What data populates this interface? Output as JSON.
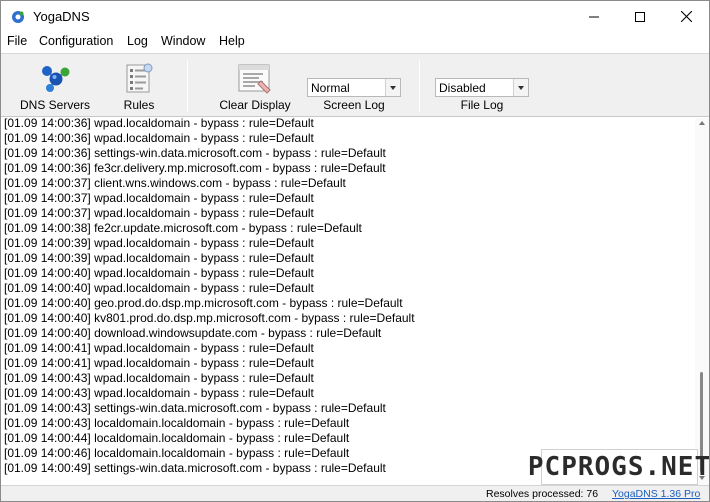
{
  "window": {
    "title": "YogaDNS"
  },
  "menu": [
    "File",
    "Configuration",
    "Log",
    "Window",
    "Help"
  ],
  "toolbar": {
    "dns_servers": "DNS Servers",
    "rules": "Rules",
    "clear_display": "Clear Display",
    "screen_log": {
      "value": "Normal",
      "caption": "Screen Log"
    },
    "file_log": {
      "value": "Disabled",
      "caption": "File Log"
    }
  },
  "log": [
    "[01.09 14:00:36] wpad.localdomain - bypass : rule=Default",
    "[01.09 14:00:36] wpad.localdomain - bypass : rule=Default",
    "[01.09 14:00:36] settings-win.data.microsoft.com - bypass : rule=Default",
    "[01.09 14:00:36] fe3cr.delivery.mp.microsoft.com - bypass : rule=Default",
    "[01.09 14:00:37] client.wns.windows.com - bypass : rule=Default",
    "[01.09 14:00:37] wpad.localdomain - bypass : rule=Default",
    "[01.09 14:00:37] wpad.localdomain - bypass : rule=Default",
    "[01.09 14:00:38] fe2cr.update.microsoft.com - bypass : rule=Default",
    "[01.09 14:00:39] wpad.localdomain - bypass : rule=Default",
    "[01.09 14:00:39] wpad.localdomain - bypass : rule=Default",
    "[01.09 14:00:40] wpad.localdomain - bypass : rule=Default",
    "[01.09 14:00:40] wpad.localdomain - bypass : rule=Default",
    "[01.09 14:00:40] geo.prod.do.dsp.mp.microsoft.com - bypass : rule=Default",
    "[01.09 14:00:40] kv801.prod.do.dsp.mp.microsoft.com - bypass : rule=Default",
    "[01.09 14:00:40] download.windowsupdate.com - bypass : rule=Default",
    "[01.09 14:00:41] wpad.localdomain - bypass : rule=Default",
    "[01.09 14:00:41] wpad.localdomain - bypass : rule=Default",
    "[01.09 14:00:43] wpad.localdomain - bypass : rule=Default",
    "[01.09 14:00:43] wpad.localdomain - bypass : rule=Default",
    "[01.09 14:00:43] settings-win.data.microsoft.com - bypass : rule=Default",
    "[01.09 14:00:43] localdomain.localdomain - bypass : rule=Default",
    "[01.09 14:00:44] localdomain.localdomain - bypass : rule=Default",
    "[01.09 14:00:46] localdomain.localdomain - bypass : rule=Default",
    "[01.09 14:00:49] settings-win.data.microsoft.com - bypass : rule=Default"
  ],
  "status": {
    "resolves": "Resolves processed: 76",
    "version": "YogaDNS 1.36 Pro"
  },
  "watermark": "PCPROGS.NET",
  "colors": {
    "toolbar_bg": "#f0f0f0",
    "link": "#1a5fbf",
    "dns_icon_blue": "#1f63c7",
    "dns_icon_green": "#3aa537"
  }
}
